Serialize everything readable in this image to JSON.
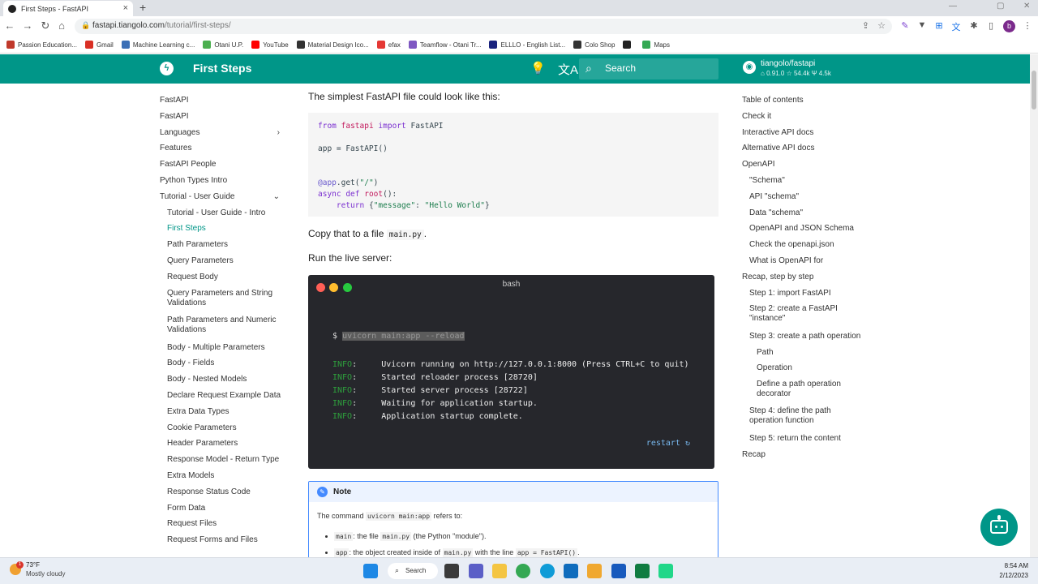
{
  "browser": {
    "tab_title": "First Steps - FastAPI",
    "url_host": "fastapi.tiangolo.com",
    "url_path": "/tutorial/first-steps/",
    "profile_initial": "b",
    "bookmarks": [
      {
        "label": "Passion Education...",
        "color": "#c0392b"
      },
      {
        "label": "Gmail",
        "color": "#d93025"
      },
      {
        "label": "Machine Learning c...",
        "color": "#3b6fb6"
      },
      {
        "label": "Otani U.P.",
        "color": "#4caf50"
      },
      {
        "label": "YouTube",
        "color": "#ff0000"
      },
      {
        "label": "Material Design Ico...",
        "color": "#333333"
      },
      {
        "label": "efax",
        "color": "#e53935"
      },
      {
        "label": "Teamflow - Otani Tr...",
        "color": "#7e57c2"
      },
      {
        "label": "ELLLO - English List...",
        "color": "#1a237e"
      },
      {
        "label": "Colo Shop",
        "color": "#333333"
      },
      {
        "label": "",
        "color": "#222222"
      },
      {
        "label": "Maps",
        "color": "#34a853"
      }
    ]
  },
  "header": {
    "site_title": "First Steps",
    "search_placeholder": "Search",
    "repo_name": "tiangolo/fastapi",
    "repo_version": "0.91.0",
    "repo_stars": "54.4k",
    "repo_forks": "4.5k",
    "brand_color": "#009688"
  },
  "leftnav": [
    {
      "label": "FastAPI",
      "level": 0
    },
    {
      "label": "FastAPI",
      "level": 0
    },
    {
      "label": "Languages",
      "level": 0,
      "chevron": "›"
    },
    {
      "label": "Features",
      "level": 0
    },
    {
      "label": "FastAPI People",
      "level": 0
    },
    {
      "label": "Python Types Intro",
      "level": 0
    },
    {
      "label": "Tutorial - User Guide",
      "level": 0,
      "chevron": "⌄"
    },
    {
      "label": "Tutorial - User Guide - Intro",
      "level": 1
    },
    {
      "label": "First Steps",
      "level": 1,
      "active": true
    },
    {
      "label": "Path Parameters",
      "level": 1
    },
    {
      "label": "Query Parameters",
      "level": 1
    },
    {
      "label": "Request Body",
      "level": 1
    },
    {
      "label": "Query Parameters and String",
      "label2": "Validations",
      "level": 1
    },
    {
      "label": "Path Parameters and Numeric",
      "label2": "Validations",
      "level": 1
    },
    {
      "label": "Body - Multiple Parameters",
      "level": 1
    },
    {
      "label": "Body - Fields",
      "level": 1
    },
    {
      "label": "Body - Nested Models",
      "level": 1
    },
    {
      "label": "Declare Request Example Data",
      "level": 1
    },
    {
      "label": "Extra Data Types",
      "level": 1
    },
    {
      "label": "Cookie Parameters",
      "level": 1
    },
    {
      "label": "Header Parameters",
      "level": 1
    },
    {
      "label": "Response Model - Return Type",
      "level": 1
    },
    {
      "label": "Extra Models",
      "level": 1
    },
    {
      "label": "Response Status Code",
      "level": 1
    },
    {
      "label": "Form Data",
      "level": 1
    },
    {
      "label": "Request Files",
      "level": 1
    },
    {
      "label": "Request Forms and Files",
      "level": 1
    }
  ],
  "main": {
    "intro": "The simplest FastAPI file could look like this:",
    "code": {
      "l1_kw": "from",
      "l1_mod": "fastapi",
      "l1_kw2": "import",
      "l1_name": "FastAPI",
      "l2": "app = FastAPI()",
      "l3_dec": "@app",
      "l3_rest": ".get(",
      "l3_str": "\"/\"",
      "l3_end": ")",
      "l4_kw": "async def",
      "l4_fn": "root",
      "l4_end": "():",
      "l5_kw": "return",
      "l5_open": "{",
      "l5_key": "\"message\"",
      "l5_colon": ": ",
      "l5_val": "\"Hello World\"",
      "l5_close": "}"
    },
    "copy_text": "Copy that to a file",
    "copy_file": "main.py",
    "copy_end": ".",
    "run_text": "Run the live server:",
    "terminal": {
      "title": "bash",
      "prompt": "$",
      "command": "uvicorn main:app --reload",
      "lines": [
        {
          "level": "INFO",
          "msg": "Uvicorn running on http://127.0.0.1:8000 (Press CTRL+C to quit)"
        },
        {
          "level": "INFO",
          "msg": "Started reloader process [28720]"
        },
        {
          "level": "INFO",
          "msg": "Started server process [28722]"
        },
        {
          "level": "INFO",
          "msg": "Waiting for application startup."
        },
        {
          "level": "INFO",
          "msg": "Application startup complete."
        }
      ],
      "restart": "restart ↻"
    },
    "note": {
      "title": "Note",
      "p_before": "The command",
      "p_code": "uvicorn main:app",
      "p_after": "refers to:",
      "b1_code": "main",
      "b1_mid": ": the file",
      "b1_code2": "main.py",
      "b1_end": "(the Python \"module\").",
      "b2_code": "app",
      "b2_mid": ": the object created inside of",
      "b2_code2": "main.py",
      "b2_mid2": "with the line",
      "b2_code3": "app = FastAPI()",
      "b2_end": "."
    }
  },
  "toc": [
    {
      "label": "Table of contents",
      "level": 0
    },
    {
      "label": "Check it",
      "level": 0
    },
    {
      "label": "Interactive API docs",
      "level": 0
    },
    {
      "label": "Alternative API docs",
      "level": 0
    },
    {
      "label": "OpenAPI",
      "level": 0
    },
    {
      "label": "\"Schema\"",
      "level": 1
    },
    {
      "label": "API \"schema\"",
      "level": 1
    },
    {
      "label": "Data \"schema\"",
      "level": 1
    },
    {
      "label": "OpenAPI and JSON Schema",
      "level": 1
    },
    {
      "label": "Check the openapi.json",
      "level": 1
    },
    {
      "label": "What is OpenAPI for",
      "level": 1
    },
    {
      "label": "Recap, step by step",
      "level": 0
    },
    {
      "label": "Step 1: import FastAPI",
      "level": 1
    },
    {
      "label": "Step 2: create a FastAPI",
      "label2": "\"instance\"",
      "level": 1
    },
    {
      "label": "Step 3: create a path operation",
      "level": 1
    },
    {
      "label": "Path",
      "level": 2
    },
    {
      "label": "Operation",
      "level": 2
    },
    {
      "label": "Define a path operation",
      "label2": "decorator",
      "level": 2
    },
    {
      "label": "Step 4: define the path",
      "label2": "operation function",
      "level": 1
    },
    {
      "label": "Step 5: return the content",
      "level": 1
    },
    {
      "label": "Recap",
      "level": 0
    }
  ],
  "taskbar": {
    "temp": "73°F",
    "condition": "Mostly cloudy",
    "weather_badge": "1",
    "search_label": "Search",
    "time": "8:54 AM",
    "date": "2/12/2023"
  }
}
